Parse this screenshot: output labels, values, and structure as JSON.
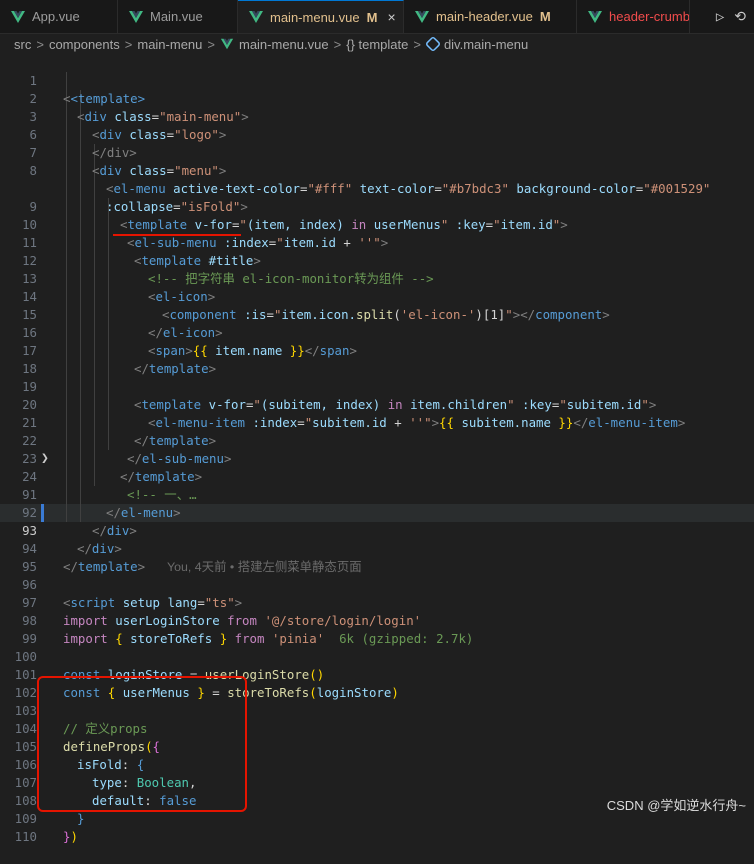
{
  "tabs": [
    {
      "label": "App.vue",
      "modified": ""
    },
    {
      "label": "Main.vue",
      "modified": ""
    },
    {
      "label": "main-menu.vue",
      "modified": "M",
      "close": "×"
    },
    {
      "label": "main-header.vue",
      "modified": "M"
    },
    {
      "label": "header-crumb",
      "modified": ""
    }
  ],
  "tab_actions": {
    "run": "▷",
    "history": "⟲"
  },
  "breadcrumbs": {
    "items": [
      "src",
      "components",
      "main-menu",
      "main-menu.vue",
      "{} template",
      "div.main-menu"
    ],
    "separator": ">"
  },
  "code": {
    "line_numbers": [
      "1",
      "2",
      "3",
      "6",
      "7",
      "8",
      "",
      "9",
      "10",
      "11",
      "12",
      "13",
      "14",
      "15",
      "16",
      "17",
      "18",
      "19",
      "20",
      "21",
      "22",
      "23",
      "24",
      "91",
      "92",
      "93",
      "94",
      "95",
      "96",
      "97",
      "98",
      "99",
      "100",
      "101",
      "102",
      "103",
      "104",
      "105",
      "106",
      "107",
      "108",
      "109",
      "110"
    ],
    "l1": "<template>",
    "l2_tag": "div",
    "l2_attr": "class",
    "l2_val": "main-menu",
    "l3_tag": "div",
    "l3_attr": "class",
    "l3_val": "logo",
    "l6": "</div>",
    "l7_tag": "div",
    "l7_attr": "class",
    "l7_val": "menu",
    "l8_tag": "el-menu",
    "l8_a1": "active-text-color",
    "l8_v1": "#fff",
    "l8_a2": "text-color",
    "l8_v2": "#b7bdc3",
    "l8_a3": "background-color",
    "l8_v3": "#001529",
    "l8b_attr": ":collapse",
    "l8b_val": "isFold",
    "l9_tag": "template",
    "l9_attr": "v-for",
    "l9_v1": "(item, index)",
    "l9_in": "in",
    "l9_v2": "userMenus",
    "l9_attr2": ":key",
    "l9_v3": "item.id",
    "l10_tag": "el-sub-menu",
    "l10_attr": ":index",
    "l10_v1": "item.id",
    "l10_plus": "+",
    "l10_v2": "''",
    "l11_tag": "template",
    "l11_attr": "#title",
    "l12": "<!-- 把字符串 el-icon-monitor转为组件 -->",
    "l13": "el-icon",
    "l14_tag": "component",
    "l14_attr": ":is",
    "l14_v1": "item.icon.",
    "l14_fn": "split",
    "l14_arg": "'el-icon-'",
    "l14_idx": "1",
    "l14_close": "component",
    "l15": "el-icon",
    "l16_tag": "span",
    "l16_expr": "item.name",
    "l17": "template",
    "l19_tag": "template",
    "l19_attr": "v-for",
    "l19_v1": "(subitem, index)",
    "l19_in": "in",
    "l19_v2": "item.children",
    "l19_attr2": ":key",
    "l19_v3": "subitem.id",
    "l20_tag": "el-menu-item",
    "l20_attr": ":index",
    "l20_v1": "subitem.id",
    "l20_plus": "+",
    "l20_v2": "''",
    "l20_expr": "subitem.name",
    "l21": "template",
    "l22": "el-sub-menu",
    "l23": "template",
    "l24": "<!-- 一、… ",
    "l91": "el-menu",
    "l92": "div",
    "l93": "div",
    "blame": "You, 4天前 • 搭建左侧菜单静态页面",
    "l94": "template",
    "l96_tag": "script",
    "l96_attr1": "setup",
    "l96_attr2": "lang",
    "l96_val": "ts",
    "l97_kw": "import",
    "l97_id": "userLoginStore",
    "l97_from": "from",
    "l97_src": "'@/store/login/login'",
    "l98_kw": "import",
    "l98_id": "storeToRefs",
    "l98_from": "from",
    "l98_src": "'pinia'",
    "l98_size": "6k (gzipped: 2.7k)",
    "l100_kw": "const",
    "l100_id": "loginStore",
    "l100_fn": "userLoginStore",
    "l101_kw": "const",
    "l101_id": "userMenus",
    "l101_fn": "storeToRefs",
    "l101_arg": "loginStore",
    "l103": "// 定义props",
    "l104_fn": "defineProps",
    "l105_key": "isFold",
    "l106_key": "type",
    "l106_val": "Boolean",
    "l107_key": "default",
    "l107_val": "false"
  },
  "watermark": "CSDN @学如逆水行舟~"
}
